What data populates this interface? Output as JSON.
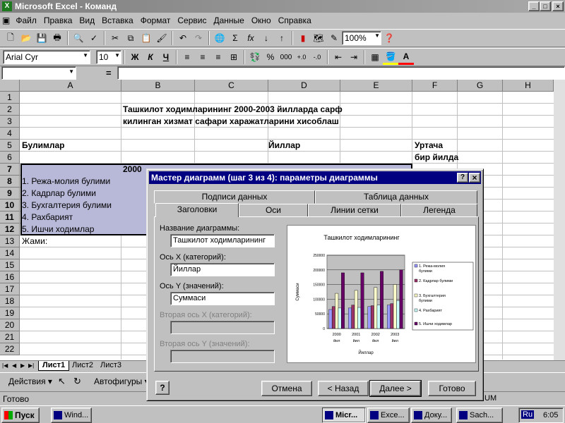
{
  "app": {
    "title": "Microsoft Excel - Команд"
  },
  "menu": [
    "Файл",
    "Правка",
    "Вид",
    "Вставка",
    "Формат",
    "Сервис",
    "Данные",
    "Окно",
    "Справка"
  ],
  "toolbar": {
    "zoom": "100%",
    "font": "Arial Cyr",
    "size": "10",
    "bold": "Ж",
    "italic": "К",
    "underline": "Ч",
    "percent": "%",
    "thousands": "000",
    "sigma": "Σ",
    "fx": "fx"
  },
  "formula": {
    "eq": "="
  },
  "columns": [
    "A",
    "B",
    "C",
    "D",
    "E",
    "F",
    "G",
    "H"
  ],
  "rows": [
    "1",
    "2",
    "3",
    "4",
    "5",
    "6",
    "7",
    "8",
    "9",
    "10",
    "11",
    "12",
    "13",
    "14",
    "15",
    "16",
    "17",
    "18",
    "19",
    "20",
    "21",
    "22"
  ],
  "sheet": {
    "title1": "Ташкилот ходимларининг 2000-2003 йилларда сарф",
    "title2": "килинган хизмат сафари харажатларини хисоблаш",
    "a5": "Булимлар",
    "d5": "Йиллар",
    "f5": "Уртача",
    "f6": "бир йилда",
    "b7": "2000",
    "items": [
      "1. Режа-молия булими",
      "2. Кадрлар булими",
      "3. Бухгалтерия булими",
      "4. Рахбарият",
      "5. Ишчи ходимлар"
    ],
    "a13": "Жами:"
  },
  "sheettabs": [
    "Лист1",
    "Лист2",
    "Лист3"
  ],
  "drawbar": {
    "actions": "Действия",
    "autoshapes": "Автофигуры"
  },
  "status": {
    "ready": "Готово",
    "num": "UM"
  },
  "dialog": {
    "title": "Мастер диаграмм (шаг 3 из 4): параметры диаграммы",
    "help": "?",
    "close": "×",
    "tabs_back": [
      "Подписи данных",
      "Таблица данных"
    ],
    "tabs_front": [
      "Заголовки",
      "Оси",
      "Линии сетки",
      "Легенда"
    ],
    "fields": [
      {
        "label": "Название диаграммы:",
        "value": "Ташкилот ходимларининг"
      },
      {
        "label": "Ось X (категорий):",
        "value": "Йиллар"
      },
      {
        "label": "Ось Y (значений):",
        "value": "Суммаси"
      },
      {
        "label": "Вторая ось X (категорий):",
        "value": ""
      },
      {
        "label": "Вторая ось Y (значений):",
        "value": ""
      }
    ],
    "buttons": {
      "cancel": "Отмена",
      "back": "< Назад",
      "next": "Далее >",
      "finish": "Готово"
    }
  },
  "chart_data": {
    "type": "bar",
    "title": "Ташкилот ходимларининг",
    "xlabel": "Йиллар",
    "ylabel": "Суммаси",
    "categories": [
      "2000 йил",
      "2001 йил",
      "2002 йил",
      "2003 йил"
    ],
    "ylim": [
      0,
      250000
    ],
    "yticks": [
      "250000",
      "200000",
      "150000",
      "100000",
      "50000",
      "0"
    ],
    "series": [
      {
        "name": "1. Режа-молия булими",
        "values": [
          65000,
          70000,
          75000,
          80000
        ],
        "color": "#9999ff"
      },
      {
        "name": "2. Кадрлар булими",
        "values": [
          75000,
          80000,
          78000,
          85000
        ],
        "color": "#993366"
      },
      {
        "name": "3. Бухгалтерия булими",
        "values": [
          120000,
          130000,
          140000,
          150000
        ],
        "color": "#ffffcc"
      },
      {
        "name": "4. Рахбарият",
        "values": [
          70000,
          72000,
          80000,
          95000
        ],
        "color": "#ccffff"
      },
      {
        "name": "5. Ишчи ходимлар",
        "values": [
          190000,
          190000,
          195000,
          200000
        ],
        "color": "#660066"
      }
    ]
  },
  "taskbar": {
    "start": "Пуск",
    "items": [
      "Wind...",
      "Micr...",
      "Exce...",
      "Доку...",
      "Sach..."
    ],
    "lang": "Ru",
    "time": "6:05"
  }
}
